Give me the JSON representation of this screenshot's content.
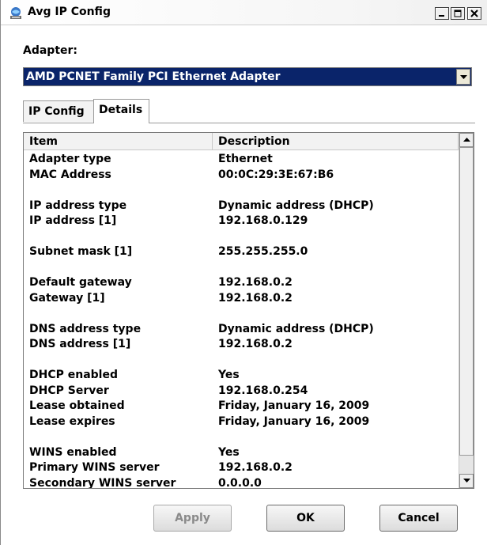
{
  "window": {
    "title": "Avg IP Config"
  },
  "adapter": {
    "label": "Adapter:",
    "selected": "AMD PCNET Family PCI Ethernet Adapter"
  },
  "tabs": [
    {
      "label": "IP Config",
      "active": false
    },
    {
      "label": "Details",
      "active": true
    }
  ],
  "table": {
    "columns": [
      "Item",
      "Description"
    ],
    "rows": [
      [
        "Adapter type",
        "Ethernet"
      ],
      [
        "MAC Address",
        "00:0C:29:3E:67:B6"
      ],
      [
        "",
        ""
      ],
      [
        "IP address type",
        "Dynamic address (DHCP)"
      ],
      [
        "IP address [1]",
        "192.168.0.129"
      ],
      [
        "",
        ""
      ],
      [
        "Subnet mask [1]",
        "255.255.255.0"
      ],
      [
        "",
        ""
      ],
      [
        "Default gateway",
        "192.168.0.2"
      ],
      [
        "Gateway [1]",
        "192.168.0.2"
      ],
      [
        "",
        ""
      ],
      [
        "DNS address type",
        "Dynamic address (DHCP)"
      ],
      [
        "DNS address [1]",
        "192.168.0.2"
      ],
      [
        "",
        ""
      ],
      [
        "DHCP enabled",
        "Yes"
      ],
      [
        "DHCP Server",
        "192.168.0.254"
      ],
      [
        "Lease obtained",
        "Friday, January 16, 2009"
      ],
      [
        "Lease expires",
        "Friday, January 16, 2009"
      ],
      [
        "",
        ""
      ],
      [
        "WINS enabled",
        "Yes"
      ],
      [
        "Primary WINS server",
        "192.168.0.2"
      ],
      [
        "Secondary WINS server",
        "0.0.0.0"
      ]
    ]
  },
  "buttons": {
    "apply": "Apply",
    "ok": "OK",
    "cancel": "Cancel"
  },
  "icons": {
    "app": "network-computer-icon",
    "minimize": "minimize-icon",
    "maximize": "maximize-icon",
    "close": "close-icon"
  }
}
